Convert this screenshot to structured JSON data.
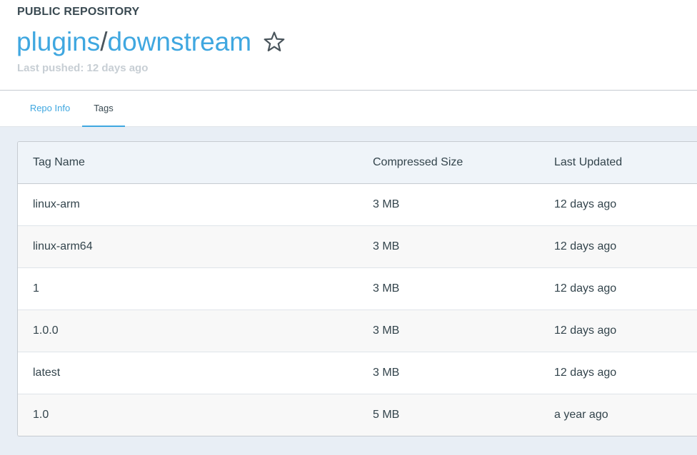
{
  "header": {
    "repo_type": "PUBLIC REPOSITORY",
    "namespace": "plugins",
    "separator": "/",
    "repo_name": "downstream",
    "last_pushed": "Last pushed: 12 days ago"
  },
  "tabs": {
    "repo_info": "Repo Info",
    "tags": "Tags",
    "active": "Tags"
  },
  "table": {
    "columns": {
      "name": "Tag Name",
      "size": "Compressed Size",
      "updated": "Last Updated"
    },
    "rows": [
      {
        "name": "linux-arm",
        "size": "3 MB",
        "updated": "12 days ago"
      },
      {
        "name": "linux-arm64",
        "size": "3 MB",
        "updated": "12 days ago"
      },
      {
        "name": "1",
        "size": "3 MB",
        "updated": "12 days ago"
      },
      {
        "name": "1.0.0",
        "size": "3 MB",
        "updated": "12 days ago"
      },
      {
        "name": "latest",
        "size": "3 MB",
        "updated": "12 days ago"
      },
      {
        "name": "1.0",
        "size": "5 MB",
        "updated": "a year ago"
      }
    ]
  },
  "colors": {
    "accent": "#3fa7e0",
    "page_bg": "#e8eef5",
    "header_row_bg": "#eff4f9"
  },
  "icons": {
    "star": "star-outline-icon"
  }
}
